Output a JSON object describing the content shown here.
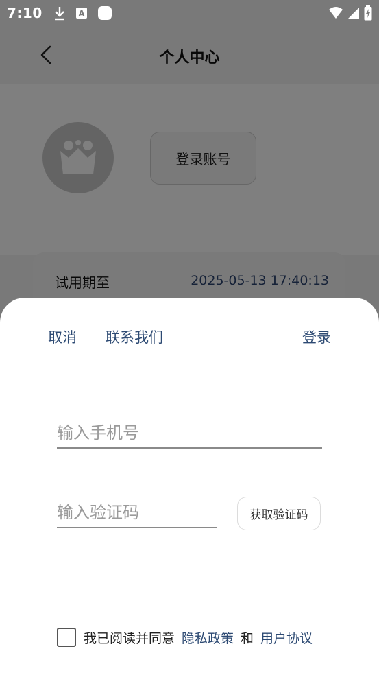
{
  "status_bar": {
    "time": "7:10",
    "left_icons": [
      "download-icon",
      "font-a-icon",
      "rounded-square-icon"
    ],
    "right_icons": [
      "wifi-icon",
      "signal-icon",
      "battery-icon"
    ]
  },
  "header": {
    "title": "个人中心"
  },
  "profile": {
    "login_button": "登录账号",
    "avatar_icon": "crown-icon"
  },
  "trial": {
    "label": "试用期至",
    "value": "2025-05-13 17:40:13"
  },
  "sheet": {
    "cancel": "取消",
    "contact": "联系我们",
    "login": "登录",
    "phone_placeholder": "输入手机号",
    "phone_value": "",
    "code_placeholder": "输入验证码",
    "code_value": "",
    "get_code": "获取验证码",
    "agreement": {
      "checked": false,
      "prefix": "我已阅读并同意",
      "privacy_policy": "隐私政策",
      "and": "和",
      "user_agreement": "用户协议"
    }
  },
  "colors": {
    "link": "#2d4a73",
    "dim_overlay": "rgba(0,0,0,0.5)",
    "sheet_bg": "#ffffff"
  }
}
